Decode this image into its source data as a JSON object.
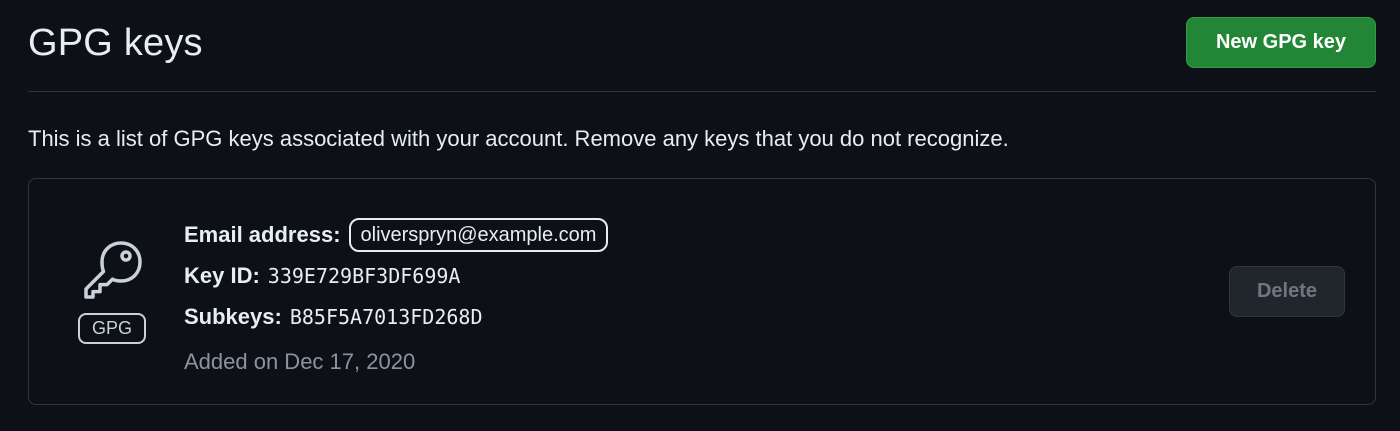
{
  "header": {
    "title": "GPG keys",
    "new_key_button": "New GPG key",
    "accent_color": "#238636"
  },
  "description": "This is a list of GPG keys associated with your account. Remove any keys that you do not recognize.",
  "keys": [
    {
      "icon": "key-icon",
      "type_badge": "GPG",
      "email_label": "Email address:",
      "email": "oliverspryn@example.com",
      "key_id_label": "Key ID:",
      "key_id": "339E729BF3DF699A",
      "subkeys_label": "Subkeys:",
      "subkeys": "B85F5A7013FD268D",
      "added": "Added on Dec 17, 2020",
      "delete_button": "Delete",
      "delete_disabled": true
    }
  ]
}
